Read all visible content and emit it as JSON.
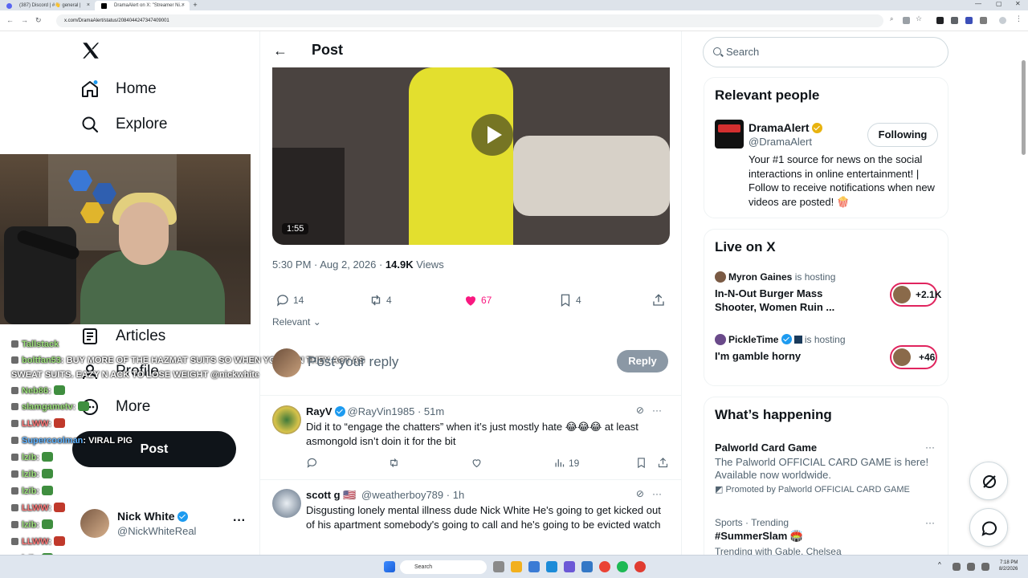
{
  "browser": {
    "tabs": [
      {
        "label": "(387) Discord | #👋 general |",
        "active": false,
        "color": "#5865f2"
      },
      {
        "label": "DramaAlert on X: \"Streamer Ni...",
        "active": true,
        "color": "#000000"
      }
    ],
    "url": "x.com/DramaAlert/status/2084044247347409001"
  },
  "left_nav": {
    "items": [
      {
        "label": "Home",
        "icon": "home-icon"
      },
      {
        "label": "Explore",
        "icon": "search-icon"
      },
      {
        "label": "Articles",
        "icon": "articles-icon"
      },
      {
        "label": "Profile",
        "icon": "person-icon"
      },
      {
        "label": "More",
        "icon": "more-circle-icon"
      }
    ],
    "post_button": "Post",
    "account": {
      "name": "Nick White",
      "handle": "@NickWhiteReal"
    }
  },
  "stream_chat": [
    {
      "user": "Tallstack",
      "msg": "",
      "color": "user"
    },
    {
      "user": "boltfan53",
      "msg": ": BUY MORE OF THE HAZMAT SUITS SO WHEN YOU RUN THEY ACT AS",
      "color": "user"
    },
    {
      "user": "",
      "msg": "SWEAT SUITS. EAZY N ACK TO LOSE WEIGHT @nickwhite",
      "color": "user"
    },
    {
      "user": "Neb86",
      "msg": ":",
      "color": "user"
    },
    {
      "user": "slamgametv",
      "msg": ":",
      "color": "user"
    },
    {
      "user": "LLWW",
      "msg": ":",
      "color": "user2"
    },
    {
      "user": "Supercoolman",
      "msg": ": VIRAL PIG",
      "color": "user3"
    },
    {
      "user": "lzib",
      "msg": ":",
      "color": "user"
    },
    {
      "user": "lzib",
      "msg": ":",
      "color": "user"
    },
    {
      "user": "lzib",
      "msg": ":",
      "color": "user"
    },
    {
      "user": "LLWW",
      "msg": ":",
      "color": "user2"
    },
    {
      "user": "lzib",
      "msg": ":",
      "color": "user"
    },
    {
      "user": "LLWW",
      "msg": ":",
      "color": "user2"
    },
    {
      "user": "lzib",
      "msg": ":",
      "color": "user"
    },
    {
      "user": "LLWW",
      "msg": ":",
      "color": "user2"
    }
  ],
  "post": {
    "header_title": "Post",
    "video_duration": "1:55",
    "timestamp": "5:30 PM · Aug 2, 2026 · ",
    "views_count": "14.9K",
    "views_label": "Views",
    "replies": "14",
    "reposts": "4",
    "likes": "67",
    "bookmarks": "4",
    "sort_label": "Relevant",
    "reply_placeholder": "Post your reply",
    "reply_button": "Reply"
  },
  "replies": [
    {
      "name": "RayV",
      "handle": "@RayVin1985",
      "time": "· 51m",
      "text": "Did it to “engage the chatters” when it’s just mostly hate 😂😂😂 at least asmongold isn’t doin it for the bit",
      "views": "19"
    },
    {
      "name": "scott g 🇺🇸",
      "handle": "@weatherboy789",
      "time": "· 1h",
      "text": "Disgusting lonely mental illness dude Nick White He's going to get kicked out of his apartment somebody's going to call and he's going to be evicted watch",
      "views": ""
    }
  ],
  "right": {
    "search_placeholder": "Search",
    "relevant_people": {
      "title": "Relevant people",
      "name": "DramaAlert",
      "handle": "@DramaAlert",
      "button": "Following",
      "bio": "Your #1 source for news on the social interactions in online entertainment! | Follow to receive notifications when new videos are posted! 🍿"
    },
    "live": {
      "title": "Live on X",
      "items": [
        {
          "host": "Myron Gaines",
          "hosting": "is hosting",
          "title": "In-N-Out Burger Mass Shooter, Women Ruin ...",
          "count": "+2.1K"
        },
        {
          "host": "PickleTime",
          "hosting": "is hosting",
          "title": "I'm gamble horny",
          "count": "+46"
        }
      ]
    },
    "happening": {
      "title": "What’s happening",
      "items": [
        {
          "name": "Palworld Card Game",
          "desc": "The Palworld OFFICIAL CARD GAME is here! Available now worldwide.",
          "promo": "Promoted by Palworld OFFICIAL CARD GAME"
        },
        {
          "category": "Sports · Trending",
          "name": "#SummerSlam 🏟️",
          "desc": "Trending with Gable, Chelsea"
        }
      ]
    }
  },
  "taskbar": {
    "search": "Search",
    "time": "7:18 PM",
    "date": "8/2/2026"
  }
}
